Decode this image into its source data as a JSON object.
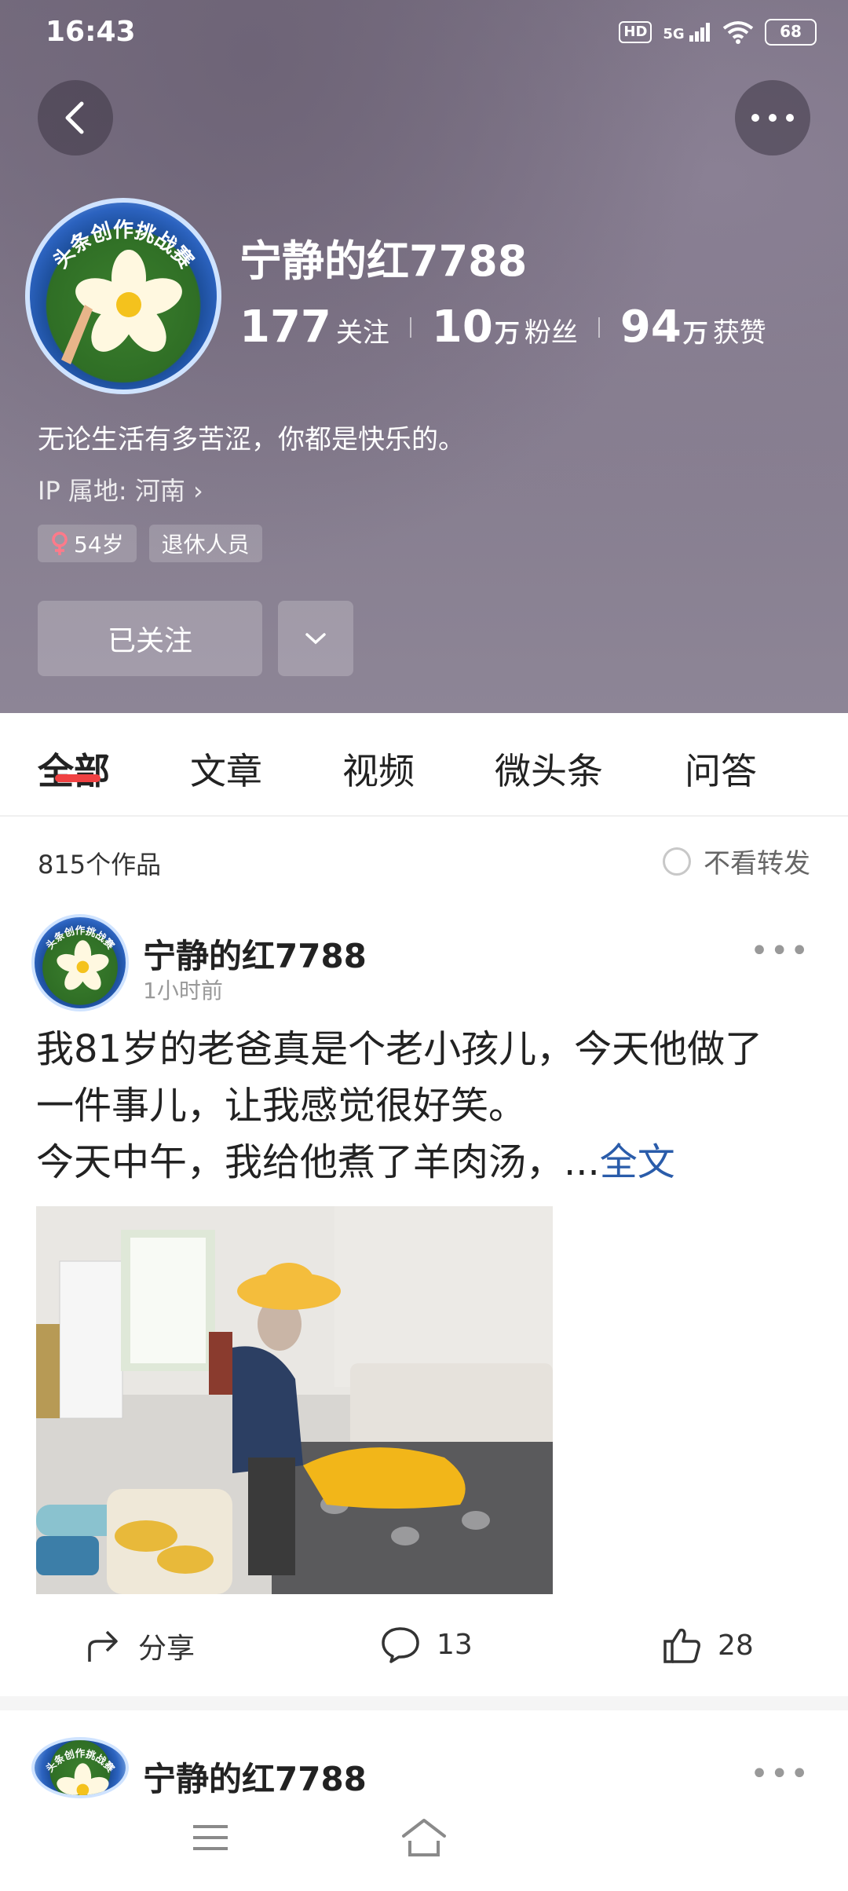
{
  "status_bar": {
    "time": "16:43",
    "hd": "HD",
    "network": "5G",
    "battery": "68"
  },
  "profile": {
    "name": "宁静的红7788",
    "stats": [
      {
        "num": "177",
        "unit": "",
        "label": "关注"
      },
      {
        "num": "10",
        "unit": "万",
        "label": "粉丝"
      },
      {
        "num": "94",
        "unit": "万",
        "label": "获赞"
      }
    ],
    "bio": "无论生活有多苦涩，你都是快乐的。",
    "ip": "IP  属地: 河南 ›",
    "tags": {
      "age": "54岁",
      "job": "退休人员"
    },
    "follow_label": "已关注",
    "badge_text": "头条创作挑战赛"
  },
  "tabs": [
    "全部",
    "文章",
    "视频",
    "微头条",
    "问答"
  ],
  "feed": {
    "count": "815个作品",
    "filter_label": "不看转发"
  },
  "post": {
    "author": "宁静的红7788",
    "time": "1小时前",
    "line1": "我81岁的老爸真是个老小孩儿，今天他做了",
    "line2": "一件事儿，让我感觉很好笑。",
    "line3": "今天中午，我给他煮了羊肉汤，...",
    "fulltext": "全文",
    "share_label": "分享",
    "comments": "13",
    "likes": "28"
  },
  "next_post": {
    "author": "宁静的红7788"
  },
  "colors": {
    "accent": "#f04142",
    "link": "#2a5caa"
  },
  "icons": [
    "back-icon",
    "more-icon",
    "female-icon",
    "chevron-down-icon",
    "share-icon",
    "comment-icon",
    "like-icon",
    "menu-icon",
    "home-icon"
  ]
}
